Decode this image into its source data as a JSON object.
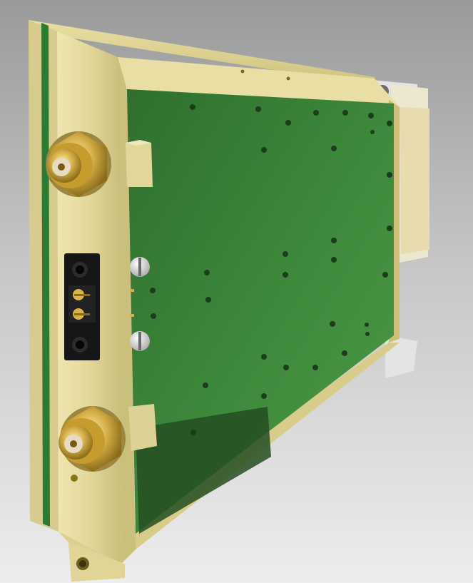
{
  "scene": {
    "subject": "",
    "colors": {
      "background_top": "#9a9a9a",
      "background_bottom": "#ededed",
      "gold_faceplate": "#e3d89a",
      "gold_edge": "#b9ae6a",
      "pcb_green": "#3f8a3c",
      "pcb_dark": "#1f5020",
      "connector_gold": "#d6b04a",
      "power_connector": "#141414",
      "rail_white": "#e6e6e6"
    },
    "components": [
      "front-panel",
      "pcb",
      "sma-connector-top",
      "sma-connector-bottom",
      "power-connector",
      "screw-top",
      "screw-bottom",
      "backplane-connector",
      "card-guide-rail",
      "mounting-tab"
    ]
  }
}
